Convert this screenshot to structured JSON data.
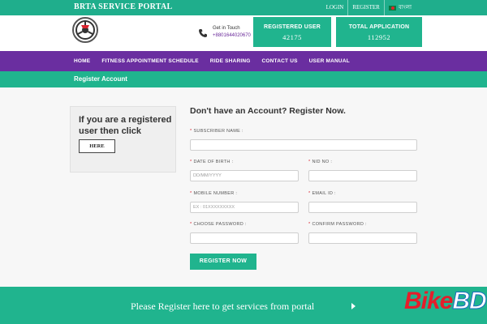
{
  "topbar": {
    "title": "BRTA SERVICE PORTAL",
    "links": [
      "LOGIN",
      "REGISTER"
    ],
    "language": "বাংলা"
  },
  "header": {
    "get_in_touch": "Get in Touch",
    "phone": "+8801644020670",
    "stats": [
      {
        "label": "REGISTERED USER",
        "value": "42175"
      },
      {
        "label": "TOTAL APPLICATION",
        "value": "112952"
      }
    ]
  },
  "nav": {
    "items": [
      "HOME",
      "FITNESS APPOINTMENT SCHEDULE",
      "RIDE SHARING",
      "CONTACT US",
      "USER MANUAL"
    ]
  },
  "section": {
    "title": "Register Account"
  },
  "login_card": {
    "text": "If you are a registered user then click",
    "button": "HERE"
  },
  "form": {
    "heading": "Don't have an Account? Register Now.",
    "subscriber_name_label": "SUBSCRIBER NAME :",
    "dob_label": "DATE OF BIRTH :",
    "dob_placeholder": "DD/MM/YYYY",
    "nid_label": "NID NO :",
    "mobile_label": "MOBILE NUMBER :",
    "mobile_placeholder": "EX : 01XXXXXXXXX",
    "email_label": "EMAIL ID :",
    "password_label": "CHOOSE PASSWORD :",
    "confirm_password_label": "CONFIRM PASSWORD :",
    "submit": "REGISTER NOW"
  },
  "footer": {
    "text": "Please Register here to get services from portal"
  },
  "watermark": {
    "part1": "Bike",
    "part2": "BD"
  },
  "colors": {
    "teal": "#20b48e",
    "purple": "#6a2ea0",
    "required": "#d9232e"
  }
}
